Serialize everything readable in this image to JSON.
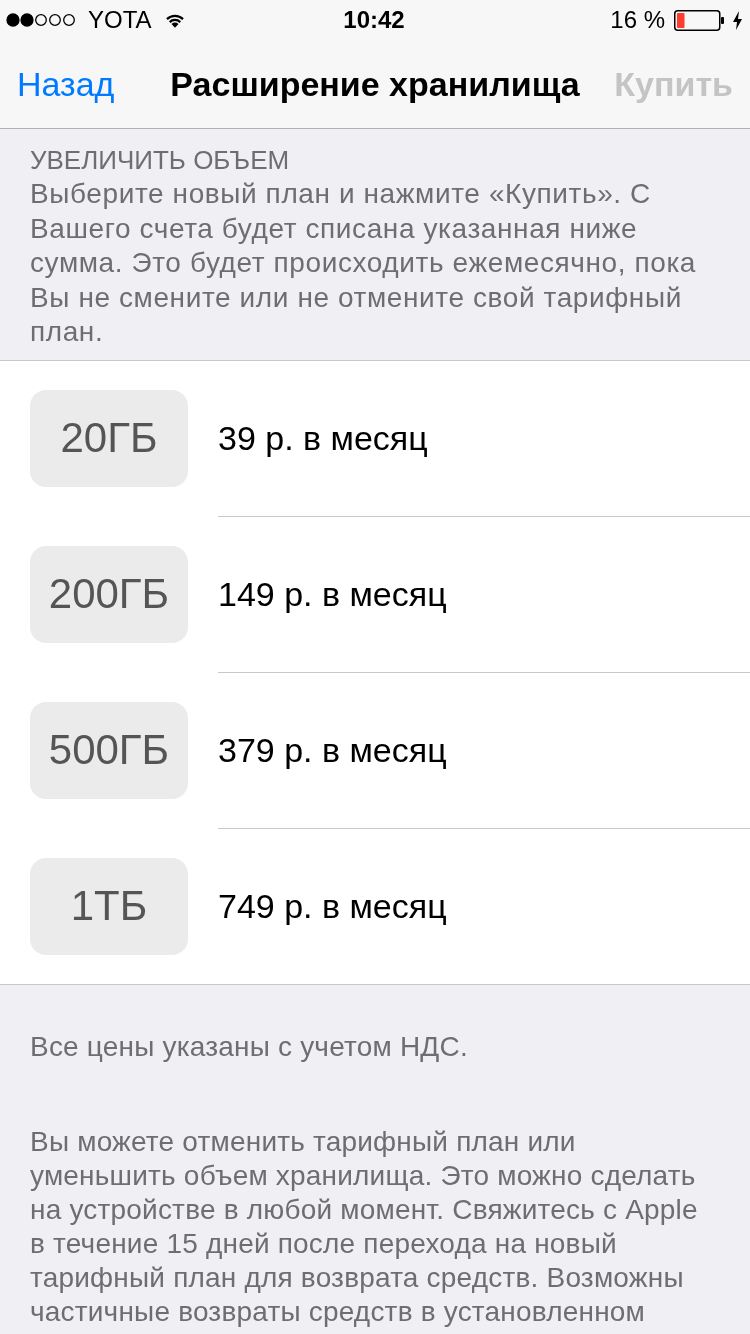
{
  "status_bar": {
    "carrier": "YOTA",
    "time": "10:42",
    "battery_text": "16 %",
    "charging": true
  },
  "nav_bar": {
    "back": {
      "label": "Назад",
      "disabled": false
    },
    "title": "Расширение хранилища",
    "action": {
      "label": "Купить",
      "disabled": true
    }
  },
  "header": {
    "title": "УВЕЛИЧИТЬ ОБЪЕМ",
    "text": "Выберите новый план и нажмите «Купить». С Вашего счета будет списана указанная ниже сумма. Это будет происходить ежемесячно, пока Вы не смените или не отмените свой тарифный план."
  },
  "plans": [
    {
      "size": "20ГБ",
      "price": "39 р. в месяц"
    },
    {
      "size": "200ГБ",
      "price": "149 р. в месяц"
    },
    {
      "size": "500ГБ",
      "price": "379 р. в месяц"
    },
    {
      "size": "1ТБ",
      "price": "749 р. в месяц"
    }
  ],
  "footer": [
    {
      "text": "Все цены указаны с учетом НДС."
    },
    {
      "text": "Вы можете отменить тарифный план или уменьшить объем хранилища. Это можно сделать на устройстве в любой момент. Свяжитесь с Apple в течение 15 дней после перехода на новый тарифный план для возврата средств. Возможны частичные возвраты средств в установленном"
    }
  ]
}
